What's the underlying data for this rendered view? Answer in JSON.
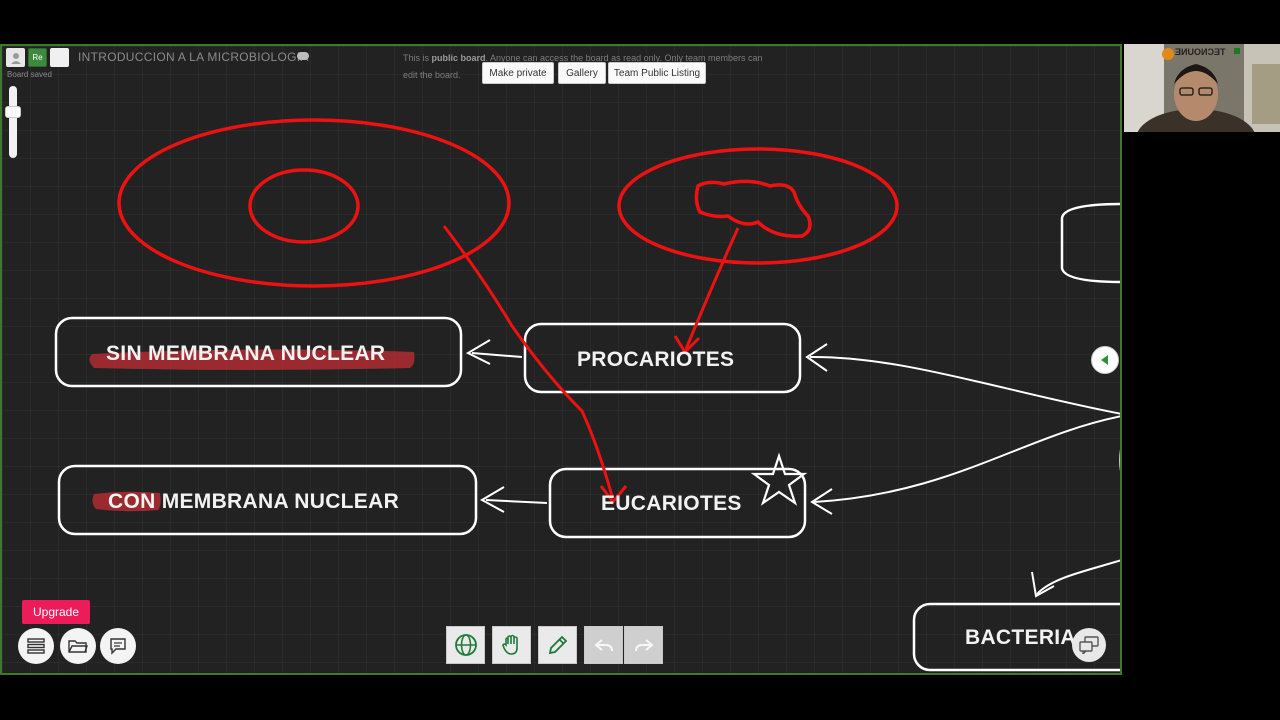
{
  "board": {
    "title": "INTRODUCCION A LA MICROBIOLOGIA",
    "status": "Board saved",
    "user_initials": "Re"
  },
  "public_notice": {
    "prefix": "This is ",
    "bold": "public board",
    "rest": ". Anyone can access the board as read only. Only team members can edit the board."
  },
  "actions": {
    "make_private": "Make private",
    "gallery": "Gallery",
    "team_public_listing": "Team Public Listing"
  },
  "nodes": {
    "sin": "SIN MEMBRANA NUCLEAR",
    "procariotes": "PROCARIOTES",
    "con": "CON MEMBRANA NUCLEAR",
    "eucariotes": "EUCARIOTES",
    "bacteria": "BACTERIA"
  },
  "upgrade": "Upgrade",
  "webcam": {
    "logo": "TECNOUNE"
  },
  "colors": {
    "board_bg": "#222222",
    "ink_white": "#ffffff",
    "ink_red": "#ee1111",
    "highlight": "#c42d35",
    "frame_green": "#3d7a2e",
    "upgrade_pink": "#ec1b5a"
  }
}
